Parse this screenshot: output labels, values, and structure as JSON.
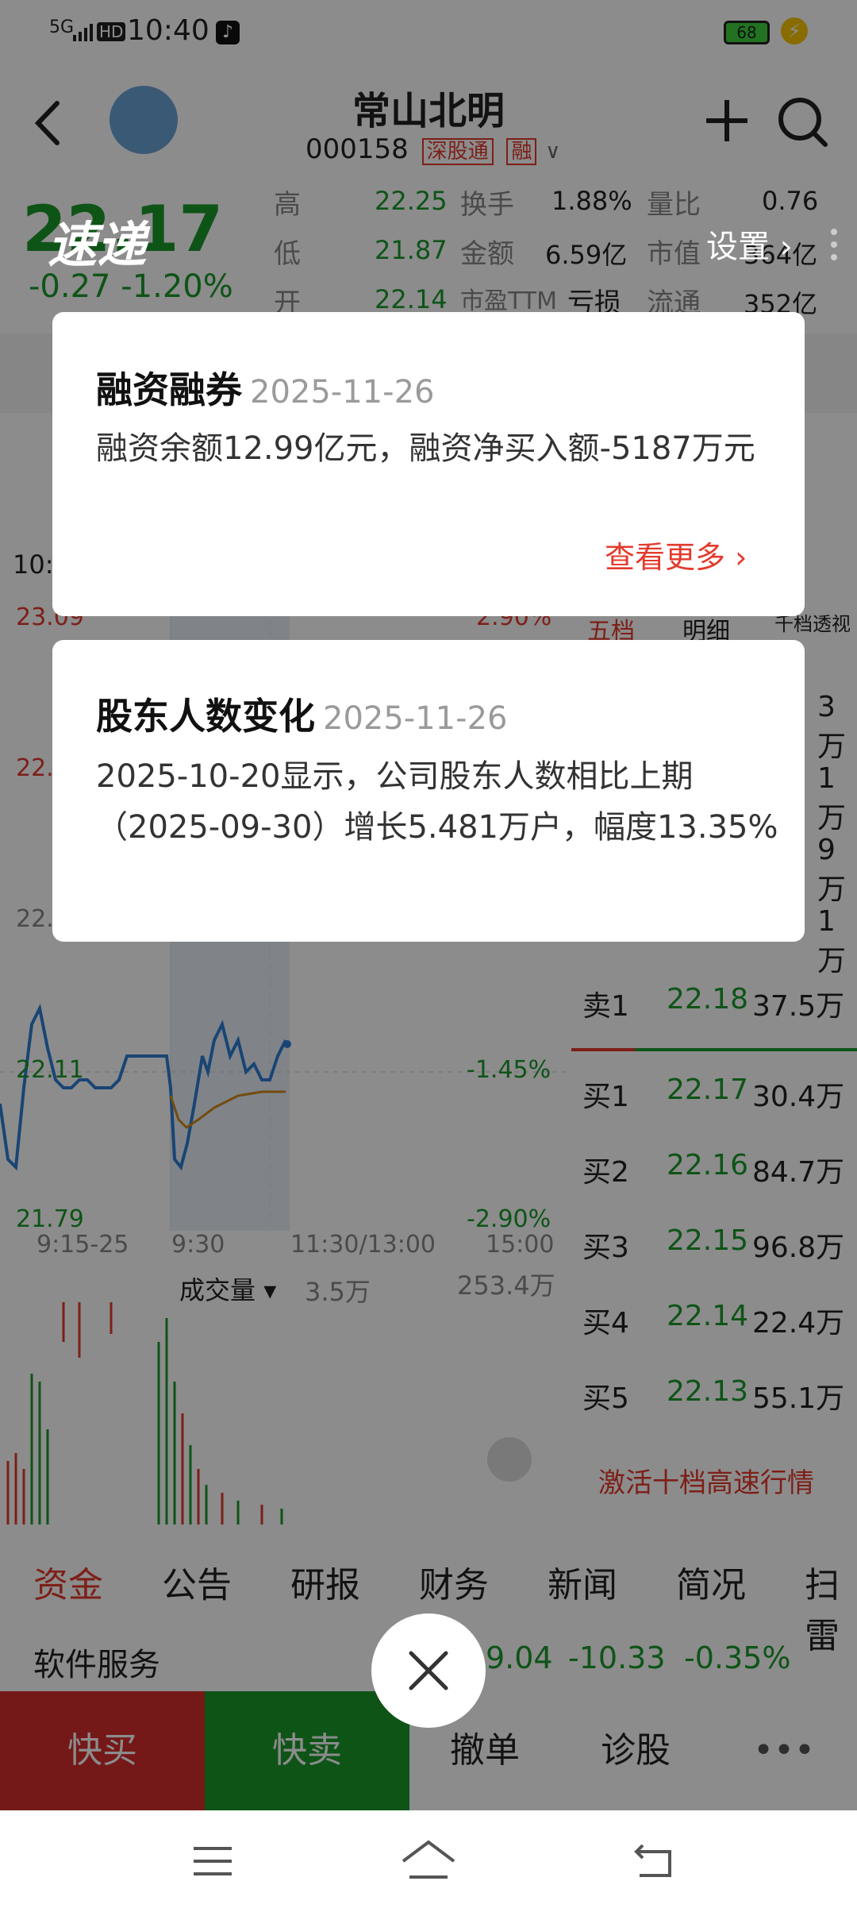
{
  "status_bar": {
    "network": "5G",
    "hd": "HD",
    "time": "10:40",
    "battery": "68"
  },
  "header": {
    "stock_name": "常山北明",
    "stock_code": "000158",
    "tag_sgt": "深股通",
    "tag_rong": "融"
  },
  "quote": {
    "price": "22.17",
    "change": "-0.27",
    "change_pct": "-1.20%",
    "rows": [
      {
        "l1": "高",
        "v1": "22.25",
        "l2": "换手",
        "v2": "1.88%",
        "l3": "量比",
        "v3": "0.76"
      },
      {
        "l1": "低",
        "v1": "21.87",
        "l2": "金额",
        "v2": "6.59亿",
        "l3": "市值",
        "v3": "364亿"
      },
      {
        "l1": "开",
        "v1": "22.14",
        "l2": "市盈TTM",
        "v2": "亏损",
        "l3": "流通",
        "v3": "352亿"
      }
    ],
    "logo_text": "速递",
    "settings_label": "设置"
  },
  "chart": {
    "time_label": "10:",
    "y_top": "23.09",
    "y_upper": "22.",
    "y_mid_upper": "22.",
    "y_mid": "22.11",
    "y_bottom": "21.79",
    "pct_top": "2.90%",
    "pct_mid": "-1.45%",
    "pct_bottom": "-2.90%",
    "x_labels": [
      "9:15-25",
      "9:30",
      "11:30/13:00",
      "15:00"
    ],
    "volume_label": "成交量",
    "volume_value": "3.5万",
    "volume_max": "253.4万"
  },
  "orderbook": {
    "tabs": [
      "五档",
      "明细",
      "千档透视"
    ],
    "sell_partial": [
      "3万",
      "1万",
      "9万",
      "1万"
    ],
    "sell1": {
      "label": "卖1",
      "price": "22.18",
      "vol": "37.5万"
    },
    "buys": [
      {
        "label": "买1",
        "price": "22.17",
        "vol": "30.4万"
      },
      {
        "label": "买2",
        "price": "22.16",
        "vol": "84.7万"
      },
      {
        "label": "买3",
        "price": "22.15",
        "vol": "96.8万"
      },
      {
        "label": "买4",
        "price": "22.14",
        "vol": "22.4万"
      },
      {
        "label": "买5",
        "price": "22.13",
        "vol": "55.1万"
      }
    ],
    "activate_label": "激活十档高速行情"
  },
  "bottom_tabs": [
    "资金",
    "公告",
    "研报",
    "财务",
    "新闻",
    "简况",
    "扫雷"
  ],
  "sector": {
    "name": "软件服务",
    "v1": "9.04",
    "v2": "-10.33",
    "v3": "-0.35%"
  },
  "actions": {
    "buy": "快买",
    "sell": "快卖",
    "cancel": "撤单",
    "diagnose": "诊股"
  },
  "cards": [
    {
      "title": "融资融券",
      "date": "2025-11-26",
      "body": "融资余额12.99亿元，融资净买入额-5187万元",
      "more": "查看更多"
    },
    {
      "title": "股东人数变化",
      "date": "2025-11-26",
      "body": "2025-10-20显示，公司股东人数相比上期（2025-09-30）增长5.481万户，幅度13.35%"
    }
  ]
}
